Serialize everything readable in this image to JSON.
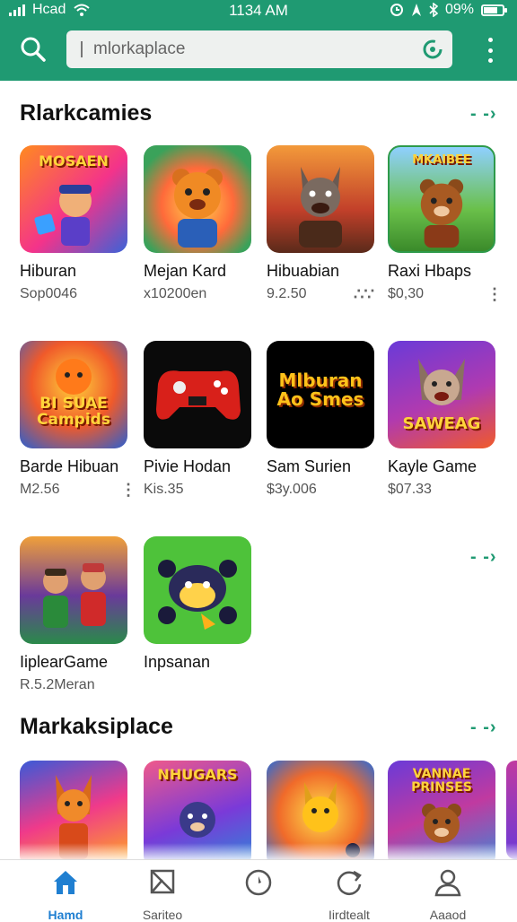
{
  "status_bar": {
    "carrier": "Hcad",
    "time": "1134 AM",
    "battery": "09%"
  },
  "search": {
    "placeholder": "mlorkaplace"
  },
  "sections": [
    {
      "title": "Rlarkcamies",
      "apps": [
        {
          "name": "Hiburan",
          "price": "Sop0046",
          "icon_text": "MOSAEN"
        },
        {
          "name": "Mejan Kard",
          "price": "x10200en",
          "icon_text": ""
        },
        {
          "name": "Hibuabian",
          "price": "9.2.50",
          "icon_text": ""
        },
        {
          "name": "Raxi Hbaps",
          "price": "$0,30",
          "icon_text": "MKAIBEE"
        },
        {
          "name": "Barde Hibuan",
          "price": "M2.56",
          "icon_text": "BI SUAE Campids"
        },
        {
          "name": "Pivie Hodan",
          "price": "Kis.35",
          "icon_text": ""
        },
        {
          "name": "Sam Surien",
          "price": "$3y.006",
          "icon_text": "Mlburan Ao Smes"
        },
        {
          "name": "Kayle Game",
          "price": "$07.33",
          "icon_text": "SAWEAG"
        },
        {
          "name": "IiplearGame",
          "price": "R.5.2Meran",
          "icon_text": ""
        },
        {
          "name": "Inpsanan",
          "price": "",
          "icon_text": ""
        }
      ]
    },
    {
      "title": "Markaksiplace",
      "apps": [
        {
          "name": "",
          "price": "",
          "icon_text": ""
        },
        {
          "name": "",
          "price": "",
          "icon_text": "NHUGARS"
        },
        {
          "name": "",
          "price": "",
          "icon_text": ""
        },
        {
          "name": "",
          "price": "",
          "icon_text": "VANNAE PRINSES"
        }
      ]
    }
  ],
  "bottom_nav": [
    {
      "label": "Hamd",
      "icon": "home-icon",
      "active": true
    },
    {
      "label": "Sariteo",
      "icon": "flag-icon",
      "active": false
    },
    {
      "label": "",
      "icon": "compass-icon",
      "active": false
    },
    {
      "label": "Iirdtealt",
      "icon": "refresh-icon",
      "active": false
    },
    {
      "label": "Aaaod",
      "icon": "person-icon",
      "active": false
    }
  ],
  "colors": {
    "accent": "#1f9a72",
    "active_nav": "#1f7fd1"
  }
}
